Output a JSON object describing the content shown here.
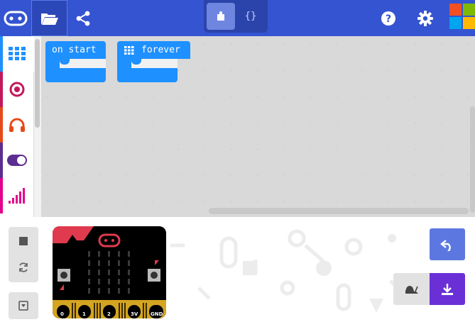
{
  "header": {
    "toggle": {
      "blocks_icon": "puzzle-icon",
      "js_label": "{}"
    }
  },
  "toolbox": [
    {
      "name": "basic",
      "icon": "grid-icon",
      "color": "#1e90ff"
    },
    {
      "name": "input",
      "icon": "target-icon",
      "color": "#c2185b"
    },
    {
      "name": "music",
      "icon": "headphones-icon",
      "color": "#e64a19"
    },
    {
      "name": "led",
      "icon": "toggle-icon",
      "color": "#5c2d91"
    },
    {
      "name": "radio",
      "icon": "signal-icon",
      "color": "#e3008c"
    }
  ],
  "workspace": {
    "blocks": [
      {
        "label": "on start"
      },
      {
        "label": "forever"
      }
    ]
  },
  "simulator": {
    "pins": [
      "0",
      "1",
      "2",
      "3V",
      "GND"
    ]
  },
  "colors": {
    "header": "#3454d1",
    "block": "#1e90ff",
    "undo": "#5c78e0",
    "download": "#6b2fd6"
  }
}
